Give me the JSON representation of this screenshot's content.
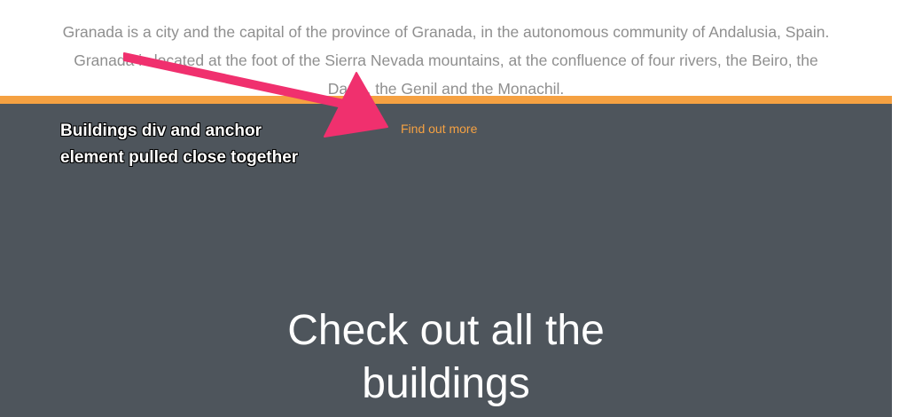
{
  "intro": {
    "lines": [
      "Granada is a city and the capital of the province of Granada, in the autonomous community of Andalusia, Spain.",
      "Granada is located at the foot of the Sierra Nevada mountains, at the confluence of four rivers, the Beiro, the",
      "Darro, the Genil and the Monachil."
    ]
  },
  "link": {
    "label": "Find out more"
  },
  "annotation": {
    "lines": [
      "Buildings div and anchor",
      "element pulled close together"
    ]
  },
  "heading": {
    "lines": [
      "Check out all the",
      "buildings"
    ]
  },
  "colors": {
    "accent": "#f5a142",
    "dark_section": "#4e555c",
    "intro_text": "#8f8f8f",
    "annotation_arrow": "#f0306e"
  },
  "icons": {
    "annotation_arrow": "arrow-icon"
  }
}
